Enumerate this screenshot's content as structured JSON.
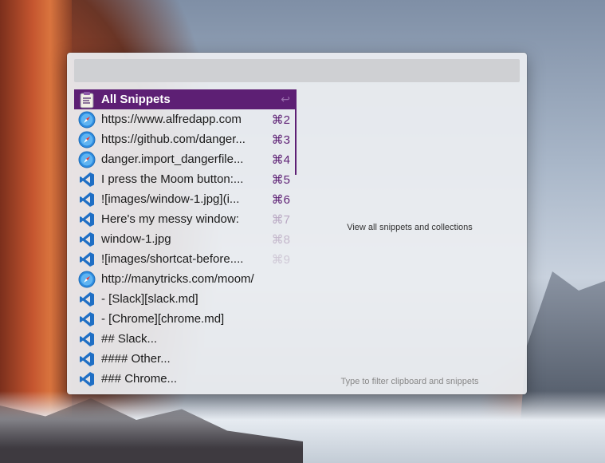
{
  "search": {
    "value": "",
    "placeholder": ""
  },
  "rows": [
    {
      "label": "All Snippets",
      "shortcut": "↩",
      "icon": "snippets-icon",
      "selected": true
    },
    {
      "label": "https://www.alfredapp.com",
      "shortcut": "⌘2",
      "icon": "safari-icon"
    },
    {
      "label": "https://github.com/danger...",
      "shortcut": "⌘3",
      "icon": "safari-icon"
    },
    {
      "label": "danger.import_dangerfile...",
      "shortcut": "⌘4",
      "icon": "safari-icon"
    },
    {
      "label": "I press the Moom button:...",
      "shortcut": "⌘5",
      "icon": "vscode-icon"
    },
    {
      "label": "![images/window-1.jpg](i...",
      "shortcut": "⌘6",
      "icon": "vscode-icon"
    },
    {
      "label": "Here's my messy window:",
      "shortcut": "⌘7",
      "icon": "vscode-icon"
    },
    {
      "label": "window-1.jpg",
      "shortcut": "⌘8",
      "icon": "vscode-icon"
    },
    {
      "label": "![images/shortcat-before....",
      "shortcut": "⌘9",
      "icon": "vscode-icon"
    },
    {
      "label": "http://manytricks.com/moom/",
      "shortcut": "",
      "icon": "safari-icon"
    },
    {
      "label": "- [Slack][slack.md]",
      "shortcut": "",
      "icon": "vscode-icon"
    },
    {
      "label": "- [Chrome][chrome.md]",
      "shortcut": "",
      "icon": "vscode-icon"
    },
    {
      "label": "## Slack...",
      "shortcut": "",
      "icon": "vscode-icon"
    },
    {
      "label": "#### Other...",
      "shortcut": "",
      "icon": "vscode-icon"
    },
    {
      "label": "### Chrome...",
      "shortcut": "",
      "icon": "vscode-icon"
    }
  ],
  "shortcut_colors": [
    "#5d1f74",
    "#5d1f74",
    "#5d1f74",
    "#5d1f74",
    "#5d1f74",
    "#b9a8c3",
    "#c4b8cc",
    "#cfc8d6"
  ],
  "preview": {
    "description": "View all snippets and collections"
  },
  "footer": {
    "hint": "Type to filter clipboard and snippets"
  },
  "colors": {
    "accent": "#5d1f74",
    "window_bg": "#eceef1",
    "search_bg": "#cfd0d3"
  }
}
